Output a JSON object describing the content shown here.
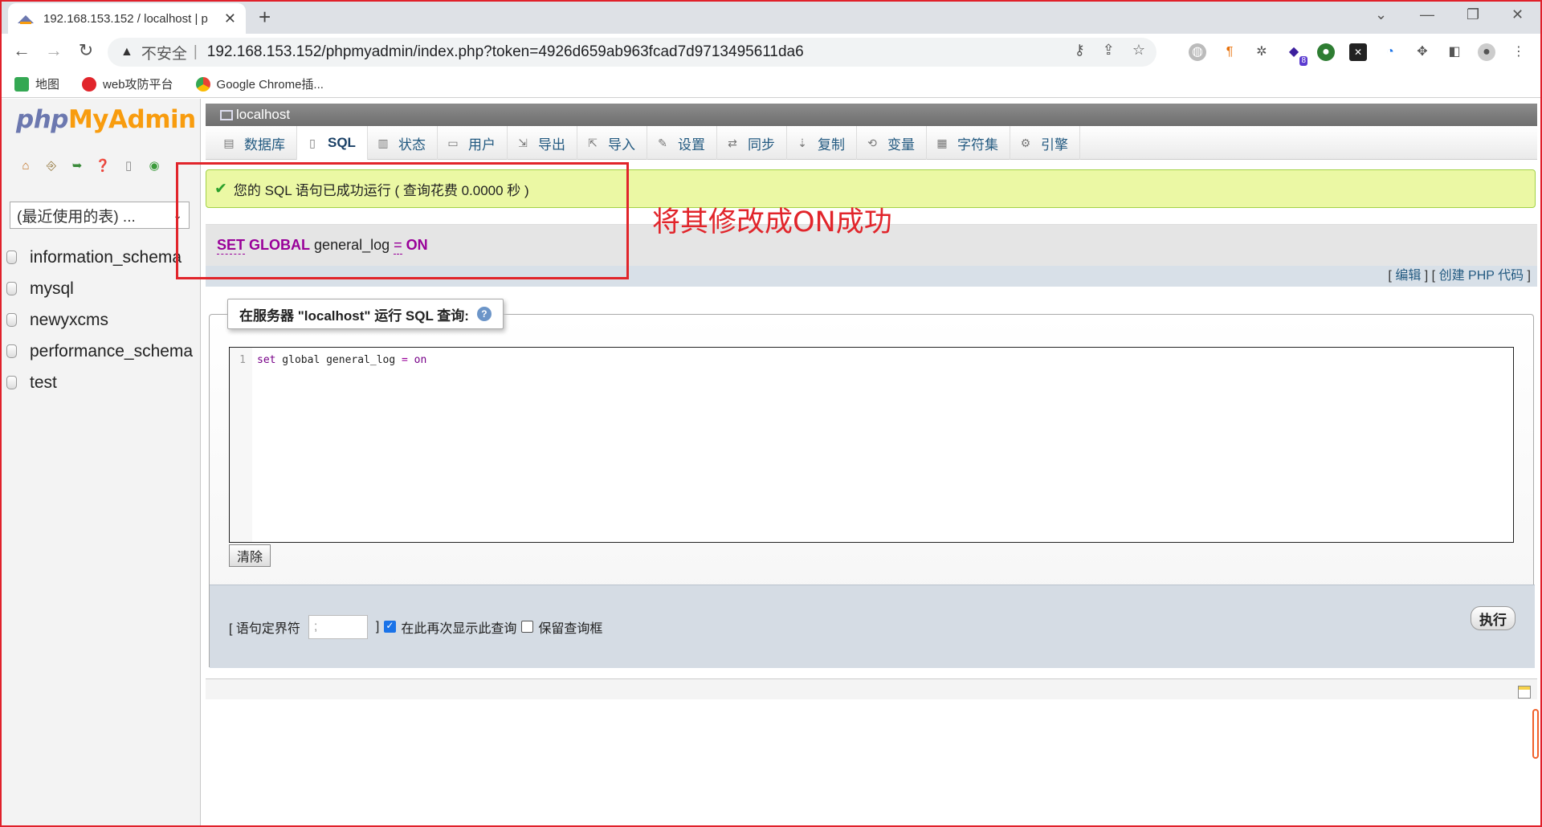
{
  "browser": {
    "tab_title": "192.168.153.152 / localhost | p",
    "tab_close": "✕",
    "new_tab": "+",
    "not_secure": "不安全",
    "url": "192.168.153.152/phpmyadmin/index.php?token=4926d659ab963fcad7d9713495611da6",
    "extension_badge": "8"
  },
  "bookmarks": [
    {
      "label": "地图",
      "icon": "maps-icon",
      "color": "#34a853"
    },
    {
      "label": "web攻防平台",
      "icon": "web-platform-icon",
      "color": "#e1252b"
    },
    {
      "label": "Google Chrome插...",
      "icon": "chrome-icon",
      "color": "#fbbc04"
    }
  ],
  "pma": {
    "logo": {
      "php": "php",
      "my": "My",
      "admin": "Admin"
    },
    "recent_tables": "(最近使用的表) ...",
    "databases": [
      "information_schema",
      "mysql",
      "newyxcms",
      "performance_schema",
      "test"
    ],
    "server_label": "localhost",
    "menu": [
      {
        "label": "数据库",
        "icon": "database-icon",
        "active": false
      },
      {
        "label": "SQL",
        "icon": "sql-icon",
        "active": true
      },
      {
        "label": "状态",
        "icon": "status-icon",
        "active": false
      },
      {
        "label": "用户",
        "icon": "users-icon",
        "active": false
      },
      {
        "label": "导出",
        "icon": "export-icon",
        "active": false
      },
      {
        "label": "导入",
        "icon": "import-icon",
        "active": false
      },
      {
        "label": "设置",
        "icon": "settings-icon",
        "active": false
      },
      {
        "label": "同步",
        "icon": "sync-icon",
        "active": false
      },
      {
        "label": "复制",
        "icon": "replication-icon",
        "active": false
      },
      {
        "label": "变量",
        "icon": "variables-icon",
        "active": false
      },
      {
        "label": "字符集",
        "icon": "charset-icon",
        "active": false
      },
      {
        "label": "引擎",
        "icon": "engines-icon",
        "active": false
      }
    ],
    "success_message": "您的 SQL 语句已成功运行 ( 查询花费 0.0000 秒 )",
    "executed_sql": {
      "set": "SET",
      "global": "GLOBAL",
      "var": "general_log",
      "op": "=",
      "value": "ON"
    },
    "edit_links": {
      "open": "[",
      "edit": "编辑",
      "mid": "] [",
      "php": "创建 PHP 代码",
      "close": "]"
    },
    "query_legend": "在服务器 \"localhost\" 运行 SQL 查询:",
    "editor": {
      "line_number": "1",
      "kw_set": "set",
      "text_mid": " global general_log ",
      "op": "=",
      "kw_on": " on"
    },
    "clear_button": "清除",
    "delimiter_label_open": "[ 语句定界符",
    "delimiter_value": ";",
    "delimiter_label_close": "]",
    "show_again_label": "在此再次显示此查询",
    "show_again_checked": true,
    "retain_box_label": "保留查询框",
    "retain_box_checked": false,
    "execute_button": "执行"
  },
  "annotation": {
    "text": "将其修改成ON成功",
    "color": "#e1252b"
  }
}
